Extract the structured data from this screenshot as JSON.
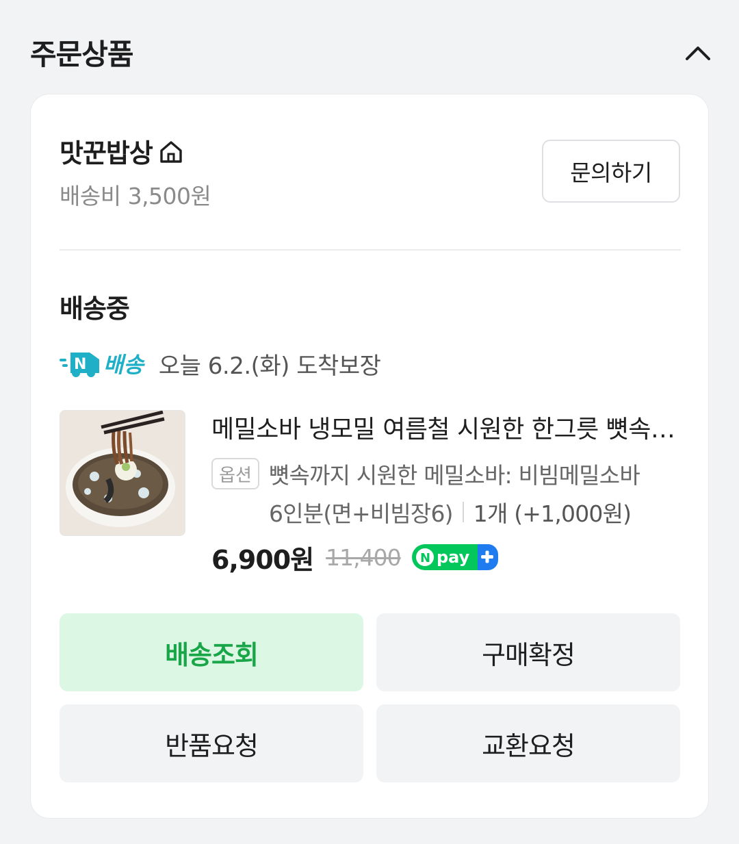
{
  "section": {
    "title": "주문상품",
    "collapse_icon": "chevron-up-icon"
  },
  "seller": {
    "name": "맛꾼밥상",
    "home_icon": "home-icon",
    "shipping_fee": "배송비 3,500원",
    "inquiry_label": "문의하기"
  },
  "order": {
    "status": "배송중",
    "delivery_badge": "배송",
    "delivery_badge_letter": "N",
    "delivery_date": "오늘 6.2.(화) 도착보장",
    "product": {
      "title": "메밀소바 냉모밀 여름철 시원한 한그릇 뼛속까지 시원한 메밀소바",
      "option_label": "옵션",
      "option_line1": "뼛속까지 시원한 메밀소바: 비빔메밀소바",
      "option_line2": "6인분(면+비빔장6)",
      "quantity": "1개 (+1,000원)",
      "price": "6,900원",
      "original_price": "11,400",
      "pay_badge": "pay"
    }
  },
  "actions": {
    "track": "배송조회",
    "confirm": "구매확정",
    "return": "반품요청",
    "exchange": "교환요청"
  },
  "colors": {
    "background": "#f2f3f5",
    "card": "#ffffff",
    "track_bg": "#dcf7e3",
    "track_text": "#18a648",
    "npay_green": "#03c75a",
    "npay_blue": "#1e7bf0",
    "delivery_badge": "#1fb0c8"
  }
}
